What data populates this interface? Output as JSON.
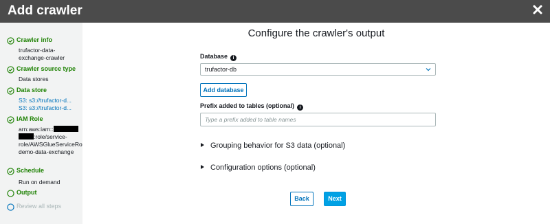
{
  "header": {
    "title": "Add crawler",
    "close_icon": "close-icon"
  },
  "sidebar": {
    "steps": [
      {
        "label": "Crawler info",
        "status": "complete",
        "details": [
          "trufactor-data-exchange-crawler"
        ]
      },
      {
        "label": "Crawler source type",
        "status": "complete",
        "details": [
          "Data stores"
        ]
      },
      {
        "label": "Data store",
        "status": "complete",
        "details": [
          "S3: s3://trufactor-d...",
          "S3: s3://trufactor-d..."
        ]
      },
      {
        "label": "IAM Role",
        "status": "complete",
        "details": {
          "prefix": "arn:aws:iam::",
          "rest": ":role/service-role/AWSGlueServiceRole-demo-data-exchange"
        }
      },
      {
        "label": "Schedule",
        "status": "complete",
        "details": [
          "Run on demand"
        ]
      },
      {
        "label": "Output",
        "status": "current"
      },
      {
        "label": "Review all steps",
        "status": "pending"
      }
    ]
  },
  "main": {
    "title": "Configure the crawler's output",
    "database": {
      "label": "Database",
      "value": "trufactor-db"
    },
    "add_database_label": "Add database",
    "prefix": {
      "label": "Prefix added to tables (optional)",
      "value": "",
      "placeholder": "Type a prefix added to table names"
    },
    "grouping_label": "Grouping behavior for S3 data (optional)",
    "config_label": "Configuration options (optional)",
    "back_label": "Back",
    "next_label": "Next"
  },
  "colors": {
    "header_bg": "#4b4b4b",
    "success": "#1d8102",
    "link": "#0073bb",
    "primary_button": "#00a1e4",
    "pending": "#aab7b8"
  }
}
